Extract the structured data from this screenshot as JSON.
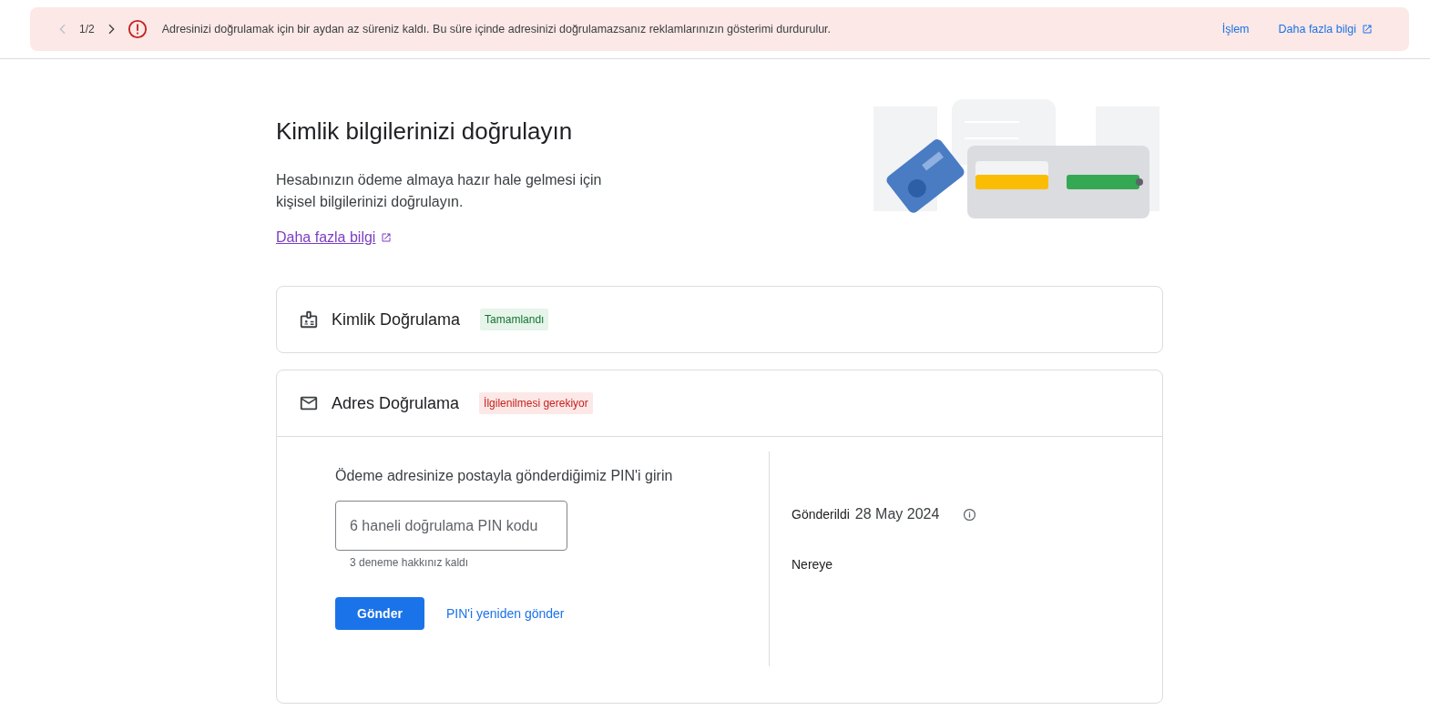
{
  "banner": {
    "pager": "1/2",
    "message": "Adresinizi doğrulamak için bir aydan az süreniz kaldı. Bu süre içinde adresinizi doğrulamazsanız reklamlarınızın gösterimi durdurulur.",
    "actions": [
      {
        "label": "İşlem",
        "external": false
      },
      {
        "label": "Daha fazla bilgi",
        "external": true
      }
    ]
  },
  "page": {
    "title": "Kimlik bilgilerinizi doğrulayın",
    "description": "Hesabınızın ödeme almaya hazır hale gelmesi için kişisel bilgilerinizi doğrulayın.",
    "link": "Daha fazla bilgi"
  },
  "sections": [
    {
      "kind": "identity",
      "title": "Kimlik Doğrulama",
      "status": {
        "label": "Tamamlandı",
        "kind": "done"
      },
      "expanded": false
    },
    {
      "kind": "address",
      "title": "Adres Doğrulama",
      "status": {
        "label": "İlgilenilmesi gerekiyor",
        "kind": "attention"
      },
      "expanded": true
    }
  ],
  "pin_form": {
    "prompt": "Ödeme adresinize postayla gönderdiğimiz PIN'i girin",
    "placeholder": "6 haneli doğrulama PIN kodu",
    "helper": "3 deneme hakkınız kaldı",
    "submit": "Gönder",
    "resend": "PIN'i yeniden gönder"
  },
  "mail_info": {
    "sent_label": "Gönderildi",
    "sent_date": "28 May 2024",
    "to_label": "Nereye"
  }
}
